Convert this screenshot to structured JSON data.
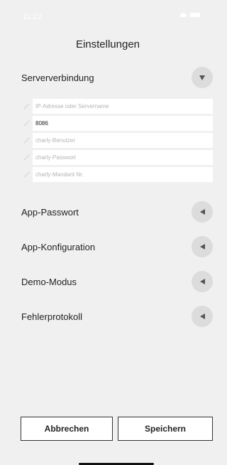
{
  "status_bar": {
    "time": "11:22"
  },
  "title": "Einstellungen",
  "server_section": {
    "label": "Serververbindung",
    "toggle_icon": "triangle-down-icon",
    "fields": [
      {
        "placeholder": "IP-Adresse oder Servername",
        "value": ""
      },
      {
        "placeholder": "",
        "value": "8086"
      },
      {
        "placeholder": "charly-Benutzer",
        "value": ""
      },
      {
        "placeholder": "charly-Passwort",
        "value": ""
      },
      {
        "placeholder": "charly-Mandant Nr.",
        "value": ""
      }
    ]
  },
  "sections": [
    {
      "label": "App-Passwort",
      "icon": "triangle-left-icon"
    },
    {
      "label": "App-Konfiguration",
      "icon": "triangle-left-icon"
    },
    {
      "label": "Demo-Modus",
      "icon": "triangle-left-icon"
    },
    {
      "label": "Fehlerprotokoll",
      "icon": "triangle-left-icon"
    }
  ],
  "buttons": {
    "cancel": "Abbrechen",
    "save": "Speichern"
  },
  "colors": {
    "background": "#f0f0f0",
    "toggle_bg": "#dcdcdc",
    "field_bg": "#ffffff"
  }
}
